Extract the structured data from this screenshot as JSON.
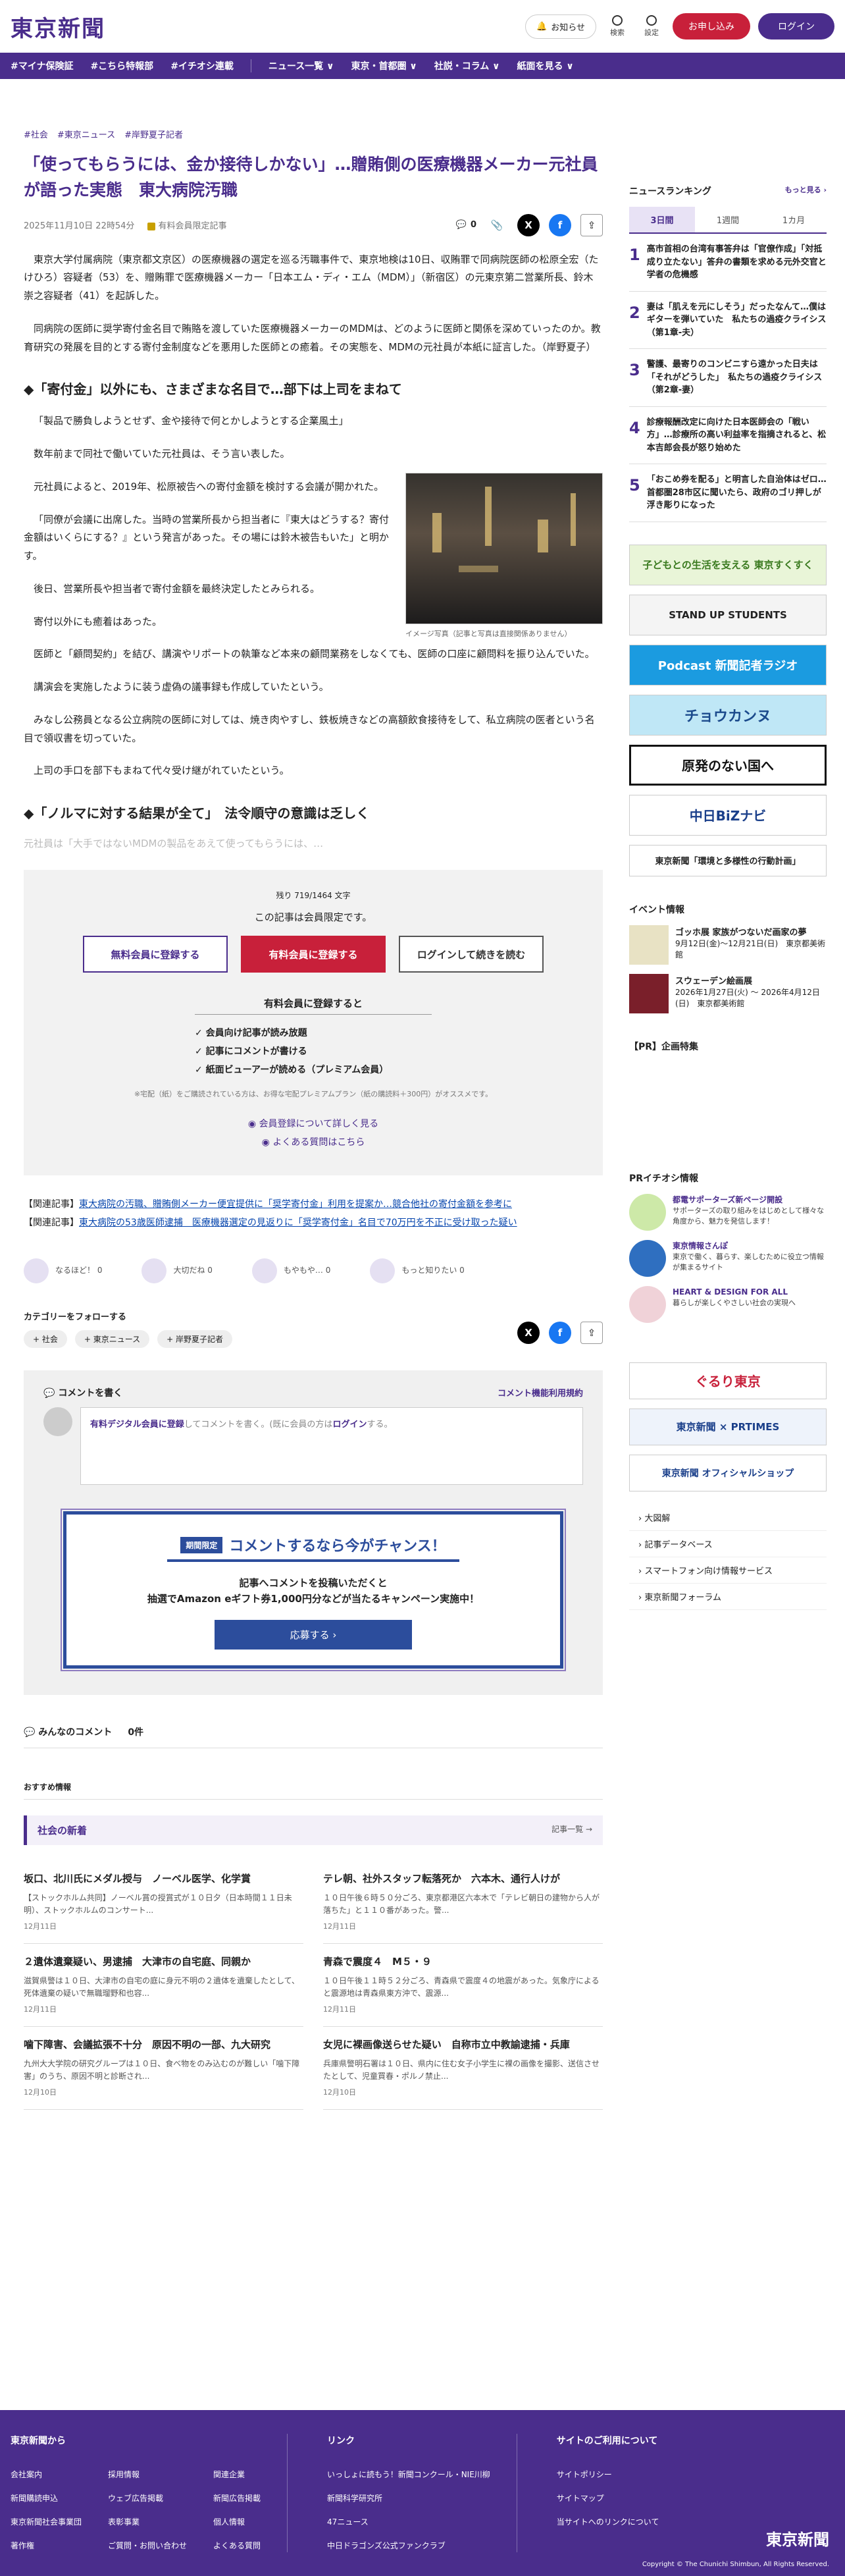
{
  "header": {
    "logo": "東京新聞",
    "notice": "お知らせ",
    "search": "検索",
    "settings": "設定",
    "apply": "お申し込み",
    "login": "ログイン"
  },
  "nav": [
    "#マイナ保険証",
    "#こちら特報部",
    "#イチオシ連載",
    "ニュース一覧 ∨",
    "東京・首都圏 ∨",
    "社説・コラム ∨",
    "紙面を見る ∨"
  ],
  "article": {
    "tags": [
      "#社会",
      "#東京ニュース",
      "#岸野夏子記者"
    ],
    "title": "「使ってもらうには、金か接待しかない」…贈賄側の医療機器メーカー元社員が語った実態　東大病院汚職",
    "date": "2025年11月10日 22時54分",
    "members": "有料会員限定記事",
    "comments": "0",
    "p1": "東京大学付属病院（東京都文京区）の医療機器の選定を巡る汚職事件で、東京地検は10日、収賄罪で同病院医師の松原全宏（たけひろ）容疑者（53）を、贈賄罪で医療機器メーカー「日本エム・ディ・エム（MDM）」（新宿区）の元東京第二営業所長、鈴木崇之容疑者（41）を起訴した。",
    "p2": "同病院の医師に奨学寄付金名目で賄賂を渡していた医療機器メーカーのMDMは、どのように医師と関係を深めていったのか。教育研究の発展を目的とする寄付金制度などを悪用した医師との癒着。その実態を、MDMの元社員が本紙に証言した。（岸野夏子）",
    "h2a": "◆「寄付金」以外にも、さまざまな名目で…部下は上司をまねて",
    "p3": "「製品で勝負しようとせず、金や接待で何とかしようとする企業風土」",
    "p4": "数年前まで同社で働いていた元社員は、そう言い表した。",
    "p5": "元社員によると、2019年、松原被告への寄付金額を検討する会議が開かれた。",
    "p6": "「同僚が会議に出席した。当時の営業所長から担当者に『東大はどうする？寄付金額はいくらにする？』という発言があった。その場には鈴木被告もいた」と明かす。",
    "p7": "後日、営業所長や担当者で寄付金額を最終決定したとみられる。",
    "p8": "寄付以外にも癒着はあった。",
    "p9": "医師と「顧問契約」を結び、講演やリポートの執筆など本来の顧問業務をしなくても、医師の口座に顧問料を振り込んでいた。",
    "p10": "講演会を実施したように装う虚偽の議事録も作成していたという。",
    "p11": "みなし公務員となる公立病院の医師に対しては、焼き肉やすし、鉄板焼きなどの高額飲食接待をして、私立病院の医者という名目で領収書を切っていた。",
    "p12": "上司の手口を部下もまねて代々受け継がれていたという。",
    "h2b": "◆「ノルマに対する結果が全て」　法令順守の意識は乏しく",
    "fade": "元社員は「大手ではないMDMの製品をあえて使ってもらうには、…",
    "photo_caption": "イメージ写真（記事と写真は直接関係ありません）"
  },
  "paywall": {
    "remain": "残り 719/1464 文字",
    "only": "この記事は会員限定です。",
    "free": "無料会員に登録する",
    "paid": "有料会員に登録する",
    "login": "ログインして続きを読む",
    "benefit_title": "有料会員に登録すると",
    "benefits": [
      "✓ 会員向け記事が読み放題",
      "✓ 記事にコメントが書ける",
      "✓ 紙面ビューアーが読める（プレミアム会員）"
    ],
    "note": "※宅配（紙）をご購読されている方は、お得な宅配プレミアムプラン（紙の購読料＋300円）がオススメです。",
    "link1": "◉ 会員登録について詳しく見る",
    "link2": "◉ よくある質問はこちら"
  },
  "related": [
    {
      "label": "【関連記事】",
      "text": "東大病院の汚職、贈賄側メーカー便宜提供に「奨学寄付金」利用を提案か…競合他社の寄付金額を参考に"
    },
    {
      "label": "【関連記事】",
      "text": "東大病院の53歳医師逮捕　医療機器選定の見返りに「奨学寄付金」名目で70万円を不正に受け取った疑い"
    }
  ],
  "reactions": [
    "なるほど！ 0",
    "大切だね 0",
    "もやもや… 0",
    "もっと知りたい 0"
  ],
  "follow": {
    "title": "カテゴリーをフォローする",
    "chips": [
      "+ 社会",
      "+ 東京ニュース",
      "+ 岸野夏子記者"
    ]
  },
  "comment": {
    "write": "コメントを書く",
    "rules": "コメント機能利用規約",
    "prompt_a": "有料デジタル会員に登録",
    "prompt_b": "してコメントを書く。(既に会員の方は",
    "prompt_c": "ログイン",
    "prompt_d": "する。",
    "camp_badge": "期間限定",
    "camp_title": "コメントするなら今がチャンス！",
    "camp_1": "記事へコメントを投稿いただくと",
    "camp_2": "抽選でAmazon eギフト券1,000円分などが当たるキャンペーン実施中！",
    "camp_btn": "応募する ›",
    "all": "みんなのコメント",
    "count": "0件"
  },
  "recommend": "おすすめ情報",
  "newest": {
    "title": "社会の新着",
    "more": "記事一覧 →"
  },
  "articles": [
    {
      "t": "坂口、北川氏にメダル授与　ノーベル医学、化学賞",
      "d": "【ストックホルム共同】ノーベル賞の授賞式が１０日夕（日本時間１１日未明）、ストックホルムのコンサート...",
      "date": "12月11日"
    },
    {
      "t": "テレ朝、社外スタッフ転落死か　六本木、通行人けが",
      "d": "１０日午後６時５０分ごろ、東京都港区六本木で「テレビ朝日の建物から人が落ちた」と１１０番があった。警...",
      "date": "12月11日"
    },
    {
      "t": "２遺体遺棄疑い、男逮捕　大津市の自宅庭、同親か",
      "d": "滋賀県警は１０日、大津市の自宅の庭に身元不明の２遺体を遺棄したとして、死体遺棄の疑いで無職瑠野和也容...",
      "date": "12月11日"
    },
    {
      "t": "青森で震度４　M５・９",
      "d": "１０日午後１１時５２分ごろ、青森県で震度４の地震があった。気象庁によると震源地は青森県東方沖で、震源...",
      "date": "12月11日"
    },
    {
      "t": "噛下障害、会議拡張不十分　原因不明の一部、九大研究",
      "d": "九州大大学院の研究グループは１０日、食べ物をのみ込むのが難しい「噛下障害」のうち、原因不明と診断され...",
      "date": "12月10日"
    },
    {
      "t": "女児に裸画像送らせた疑い　自称市立中教諭逮捕・兵庫",
      "d": "兵庫県警明石署は１０日、県内に住む女子小学生に裸の画像を撮影、送信させたとして、児童買春・ポルノ禁止...",
      "date": "12月10日"
    }
  ],
  "side": {
    "rank_title": "ニュースランキング",
    "rank_more": "もっと見る ›",
    "tabs": [
      "3日間",
      "1週間",
      "1カ月"
    ],
    "ranks": [
      "高市首相の台湾有事答弁は「官僚作成」「対抵成り立たない」答弁の書類を求める元外交官と学者の危機感",
      "妻は「肌えを元にしそう」だったなんて…僕はギターを弾いていた　私たちの過疫クライシス（第1章-夫）",
      "警護、最寄りのコンビニすら遠かった日夫は「それがどうした」　私たちの過疫クライシス（第2章-妻）",
      "診療報酬改定に向けた日本医師会の「戦い方」…診療所の高い利益率を指摘されると、松本吉郎会長が怒り始めた",
      "「おこめ券を配る」と明言した自治体はゼロ…首都圏28市区に聞いたら、政府のゴリ押しが浮き彫りになった"
    ],
    "banners": [
      "子どもとの生活を支える 東京すくすく",
      "STAND UP STUDENTS",
      "Podcast 新聞記者ラジオ",
      "チョウカンヌ",
      "原発のない国へ",
      "中日BiZナビ",
      "東京新聞「環境と多様性の行動計画」"
    ],
    "events_title": "イベント情報",
    "events": [
      {
        "t": "ゴッホ展 家族がつないだ画家の夢",
        "d": "9月12日(金)〜12月21日(日)　東京都美術館"
      },
      {
        "t": "スウェーデン絵画展",
        "d": "2026年1月27日(火) 〜 2026年4月12日(日)　東京都美術館"
      }
    ],
    "pr_title": "【PR】企画特集",
    "pr2_title": "PRイチオシ情報",
    "pr": [
      {
        "t": "都電サポーターズ新ページ開設",
        "d": "サポーターズの取り組みをはじめとして様々な角度から、魅力を発信します！"
      },
      {
        "t": "東京情報さんぽ",
        "d": "東京で働く、暮らす、楽しむために役立つ情報が集まるサイト"
      },
      {
        "t": "HEART & DESIGN FOR ALL",
        "d": "暮らしが楽しくやさしい社会の実現へ"
      }
    ],
    "banners2": [
      "ぐるり東京",
      "東京新聞 × PRTIMES",
      "東京新聞 オフィシャルショップ"
    ],
    "links": [
      "› 大図解",
      "› 記事データベース",
      "› スマートフォン向け情報サービス",
      "› 東京新聞フォーラム"
    ]
  },
  "footer": {
    "h1": "東京新聞から",
    "c1": [
      "会社案内",
      "新聞購読申込",
      "東京新聞社会事業団",
      "著作権"
    ],
    "c2": [
      "採用情報",
      "ウェブ広告掲載",
      "表彰事業",
      "ご質問・お問い合わせ"
    ],
    "c3": [
      "関連企業",
      "新聞広告掲載",
      "個人情報",
      "よくある質問"
    ],
    "h2": "リンク",
    "l": [
      "いっしょに読もう！新聞コンクール・NIE川柳",
      "新聞科学研究所",
      "47ニュース",
      "中日ドラゴンズ公式ファンクラブ"
    ],
    "h3": "サイトのご利用について",
    "s": [
      "サイトポリシー",
      "サイトマップ",
      "当サイトへのリンクについて"
    ],
    "logo": "東京新聞",
    "copy": "Copyright © The Chunichi Shimbun, All Rights Reserved."
  }
}
